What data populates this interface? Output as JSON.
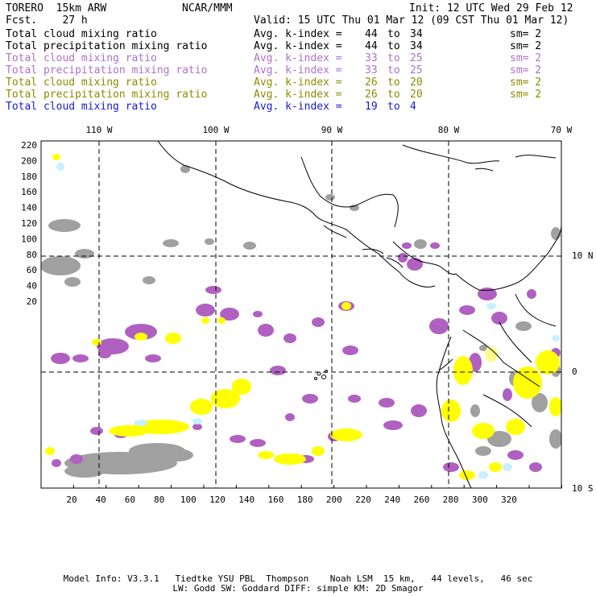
{
  "header": {
    "model": "TORERO  15km ARW",
    "center": "NCAR/MMM",
    "init": "Init: 12 UTC Wed 29 Feb 12",
    "fcst": "Fcst.    27 h",
    "valid": "Valid: 15 UTC Thu 01 Mar 12 (09 CST Thu 01 Mar 12)"
  },
  "legend": [
    {
      "name": "Total cloud mixing ratio",
      "stat": "Avg. k-index =",
      "v1": "44",
      "to": "to",
      "v2": "34",
      "sm": "sm= 2",
      "color": "#000000"
    },
    {
      "name": "Total precipitation mixing ratio",
      "stat": "Avg. k-index =",
      "v1": "44",
      "to": "to",
      "v2": "34",
      "sm": "sm= 2",
      "color": "#000000"
    },
    {
      "name": "Total cloud mixing ratio",
      "stat": "Avg. k-index =",
      "v1": "33",
      "to": "to",
      "v2": "25",
      "sm": "sm= 2",
      "color": "#b070c8"
    },
    {
      "name": "Total precipitation mixing ratio",
      "stat": "Avg. k-index =",
      "v1": "33",
      "to": "to",
      "v2": "25",
      "sm": "sm= 2",
      "color": "#b070c8"
    },
    {
      "name": "Total cloud mixing ratio",
      "stat": "Avg. k-index =",
      "v1": "26",
      "to": "to",
      "v2": "20",
      "sm": "sm= 2",
      "color": "#8c8c00"
    },
    {
      "name": "Total precipitation mixing ratio",
      "stat": "Avg. k-index =",
      "v1": "26",
      "to": "to",
      "v2": "20",
      "sm": "sm= 2",
      "color": "#8c8c00"
    },
    {
      "name": "Total cloud mixing ratio",
      "stat": "Avg. k-index =",
      "v1": "19",
      "to": "to",
      "v2": "4",
      "sm": "",
      "color": "#1a1ad0"
    }
  ],
  "map": {
    "top_labels": [
      "110 W",
      "100 W",
      "90 W",
      "80 W",
      "70 W"
    ],
    "right_labels": [
      "10 N",
      "0",
      "10 S"
    ],
    "y_ticks": [
      "220",
      "200",
      "180",
      "160",
      "140",
      "120",
      "100",
      "80",
      "60",
      "40",
      "20"
    ],
    "x_ticks": [
      "20",
      "40",
      "60",
      "80",
      "100",
      "120",
      "140",
      "160",
      "180",
      "200",
      "220",
      "240",
      "260",
      "280",
      "300",
      "320"
    ],
    "field_colors": {
      "gray": "#a0a0a0",
      "purple": "#b060c0",
      "yellow": "#ffff00",
      "light_yellow": "#ffff90",
      "light_blue": "#c8f0ff"
    }
  },
  "footer": {
    "line1": "Model Info: V3.3.1   Tiedtke YSU PBL  Thompson    Noah LSM  15 km,   44 levels,   46 sec",
    "line2": "LW: Godd SW: Goddard DIFF: simple KM: 2D Smagor"
  }
}
